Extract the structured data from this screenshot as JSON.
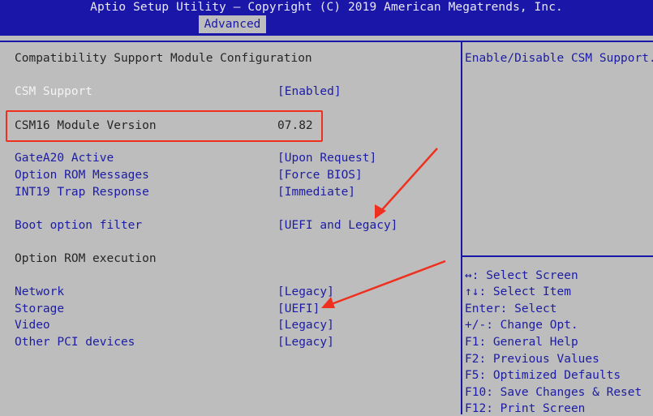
{
  "header": {
    "title": "Aptio Setup Utility – Copyright (C) 2019 American Megatrends, Inc.",
    "active_tab": "Advanced"
  },
  "main": {
    "section_title": "Compatibility Support Module Configuration",
    "csm_support": {
      "label": "CSM Support",
      "value": "[Enabled]"
    },
    "csm16_version": {
      "label": "CSM16 Module Version",
      "value": "07.82"
    },
    "gatea20": {
      "label": "GateA20 Active",
      "value": "[Upon Request]"
    },
    "option_rom_messages": {
      "label": "Option ROM Messages",
      "value": "[Force BIOS]"
    },
    "int19": {
      "label": "INT19 Trap Response",
      "value": "[Immediate]"
    },
    "boot_filter": {
      "label": "Boot option filter",
      "value": "[UEFI and Legacy]"
    },
    "option_rom_execution": "Option ROM execution",
    "network": {
      "label": "Network",
      "value": "[Legacy]"
    },
    "storage": {
      "label": "Storage",
      "value": "[UEFI]"
    },
    "video": {
      "label": "Video",
      "value": "[Legacy]"
    },
    "other_pci": {
      "label": "Other PCI devices",
      "value": "[Legacy]"
    }
  },
  "help": {
    "description": "Enable/Disable CSM Support.",
    "keys": [
      "↔: Select Screen",
      "↑↓: Select Item",
      "Enter: Select",
      "+/-: Change Opt.",
      "F1: General Help",
      "F2: Previous Values",
      "F5: Optimized Defaults",
      "F10: Save Changes & Reset",
      "F12: Print Screen"
    ]
  },
  "colors": {
    "background": "#bdbdbd",
    "bios_blue": "#1a17a8",
    "highlight_red": "#f0301e",
    "selected_text": "#f4f4f4"
  }
}
